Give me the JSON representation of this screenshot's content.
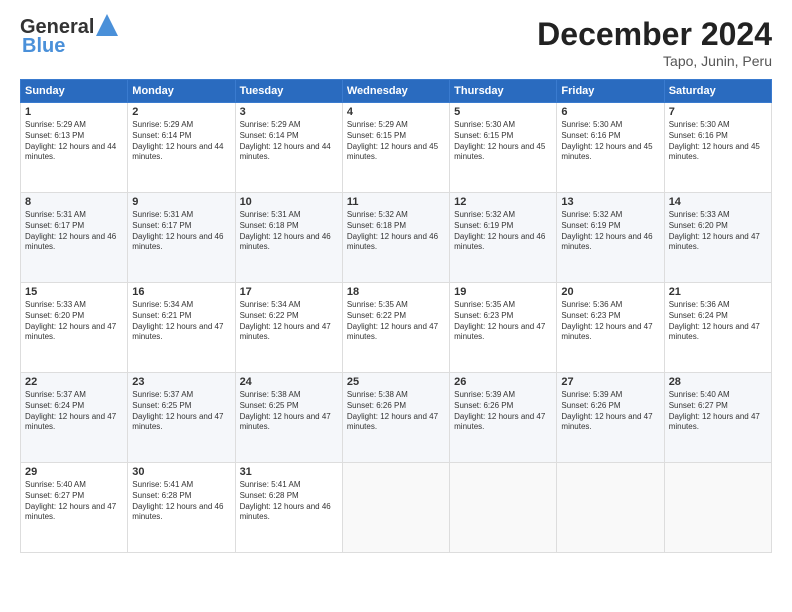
{
  "logo": {
    "line1": "General",
    "line2": "Blue"
  },
  "title": "December 2024",
  "subtitle": "Tapo, Junin, Peru",
  "days_header": [
    "Sunday",
    "Monday",
    "Tuesday",
    "Wednesday",
    "Thursday",
    "Friday",
    "Saturday"
  ],
  "weeks": [
    [
      {
        "day": "1",
        "rise": "5:29 AM",
        "set": "6:13 PM",
        "daylight": "12 hours and 44 minutes."
      },
      {
        "day": "2",
        "rise": "5:29 AM",
        "set": "6:14 PM",
        "daylight": "12 hours and 44 minutes."
      },
      {
        "day": "3",
        "rise": "5:29 AM",
        "set": "6:14 PM",
        "daylight": "12 hours and 44 minutes."
      },
      {
        "day": "4",
        "rise": "5:29 AM",
        "set": "6:15 PM",
        "daylight": "12 hours and 45 minutes."
      },
      {
        "day": "5",
        "rise": "5:30 AM",
        "set": "6:15 PM",
        "daylight": "12 hours and 45 minutes."
      },
      {
        "day": "6",
        "rise": "5:30 AM",
        "set": "6:16 PM",
        "daylight": "12 hours and 45 minutes."
      },
      {
        "day": "7",
        "rise": "5:30 AM",
        "set": "6:16 PM",
        "daylight": "12 hours and 45 minutes."
      }
    ],
    [
      {
        "day": "8",
        "rise": "5:31 AM",
        "set": "6:17 PM",
        "daylight": "12 hours and 46 minutes."
      },
      {
        "day": "9",
        "rise": "5:31 AM",
        "set": "6:17 PM",
        "daylight": "12 hours and 46 minutes."
      },
      {
        "day": "10",
        "rise": "5:31 AM",
        "set": "6:18 PM",
        "daylight": "12 hours and 46 minutes."
      },
      {
        "day": "11",
        "rise": "5:32 AM",
        "set": "6:18 PM",
        "daylight": "12 hours and 46 minutes."
      },
      {
        "day": "12",
        "rise": "5:32 AM",
        "set": "6:19 PM",
        "daylight": "12 hours and 46 minutes."
      },
      {
        "day": "13",
        "rise": "5:32 AM",
        "set": "6:19 PM",
        "daylight": "12 hours and 46 minutes."
      },
      {
        "day": "14",
        "rise": "5:33 AM",
        "set": "6:20 PM",
        "daylight": "12 hours and 47 minutes."
      }
    ],
    [
      {
        "day": "15",
        "rise": "5:33 AM",
        "set": "6:20 PM",
        "daylight": "12 hours and 47 minutes."
      },
      {
        "day": "16",
        "rise": "5:34 AM",
        "set": "6:21 PM",
        "daylight": "12 hours and 47 minutes."
      },
      {
        "day": "17",
        "rise": "5:34 AM",
        "set": "6:22 PM",
        "daylight": "12 hours and 47 minutes."
      },
      {
        "day": "18",
        "rise": "5:35 AM",
        "set": "6:22 PM",
        "daylight": "12 hours and 47 minutes."
      },
      {
        "day": "19",
        "rise": "5:35 AM",
        "set": "6:23 PM",
        "daylight": "12 hours and 47 minutes."
      },
      {
        "day": "20",
        "rise": "5:36 AM",
        "set": "6:23 PM",
        "daylight": "12 hours and 47 minutes."
      },
      {
        "day": "21",
        "rise": "5:36 AM",
        "set": "6:24 PM",
        "daylight": "12 hours and 47 minutes."
      }
    ],
    [
      {
        "day": "22",
        "rise": "5:37 AM",
        "set": "6:24 PM",
        "daylight": "12 hours and 47 minutes."
      },
      {
        "day": "23",
        "rise": "5:37 AM",
        "set": "6:25 PM",
        "daylight": "12 hours and 47 minutes."
      },
      {
        "day": "24",
        "rise": "5:38 AM",
        "set": "6:25 PM",
        "daylight": "12 hours and 47 minutes."
      },
      {
        "day": "25",
        "rise": "5:38 AM",
        "set": "6:26 PM",
        "daylight": "12 hours and 47 minutes."
      },
      {
        "day": "26",
        "rise": "5:39 AM",
        "set": "6:26 PM",
        "daylight": "12 hours and 47 minutes."
      },
      {
        "day": "27",
        "rise": "5:39 AM",
        "set": "6:26 PM",
        "daylight": "12 hours and 47 minutes."
      },
      {
        "day": "28",
        "rise": "5:40 AM",
        "set": "6:27 PM",
        "daylight": "12 hours and 47 minutes."
      }
    ],
    [
      {
        "day": "29",
        "rise": "5:40 AM",
        "set": "6:27 PM",
        "daylight": "12 hours and 47 minutes."
      },
      {
        "day": "30",
        "rise": "5:41 AM",
        "set": "6:28 PM",
        "daylight": "12 hours and 46 minutes."
      },
      {
        "day": "31",
        "rise": "5:41 AM",
        "set": "6:28 PM",
        "daylight": "12 hours and 46 minutes."
      },
      null,
      null,
      null,
      null
    ]
  ]
}
